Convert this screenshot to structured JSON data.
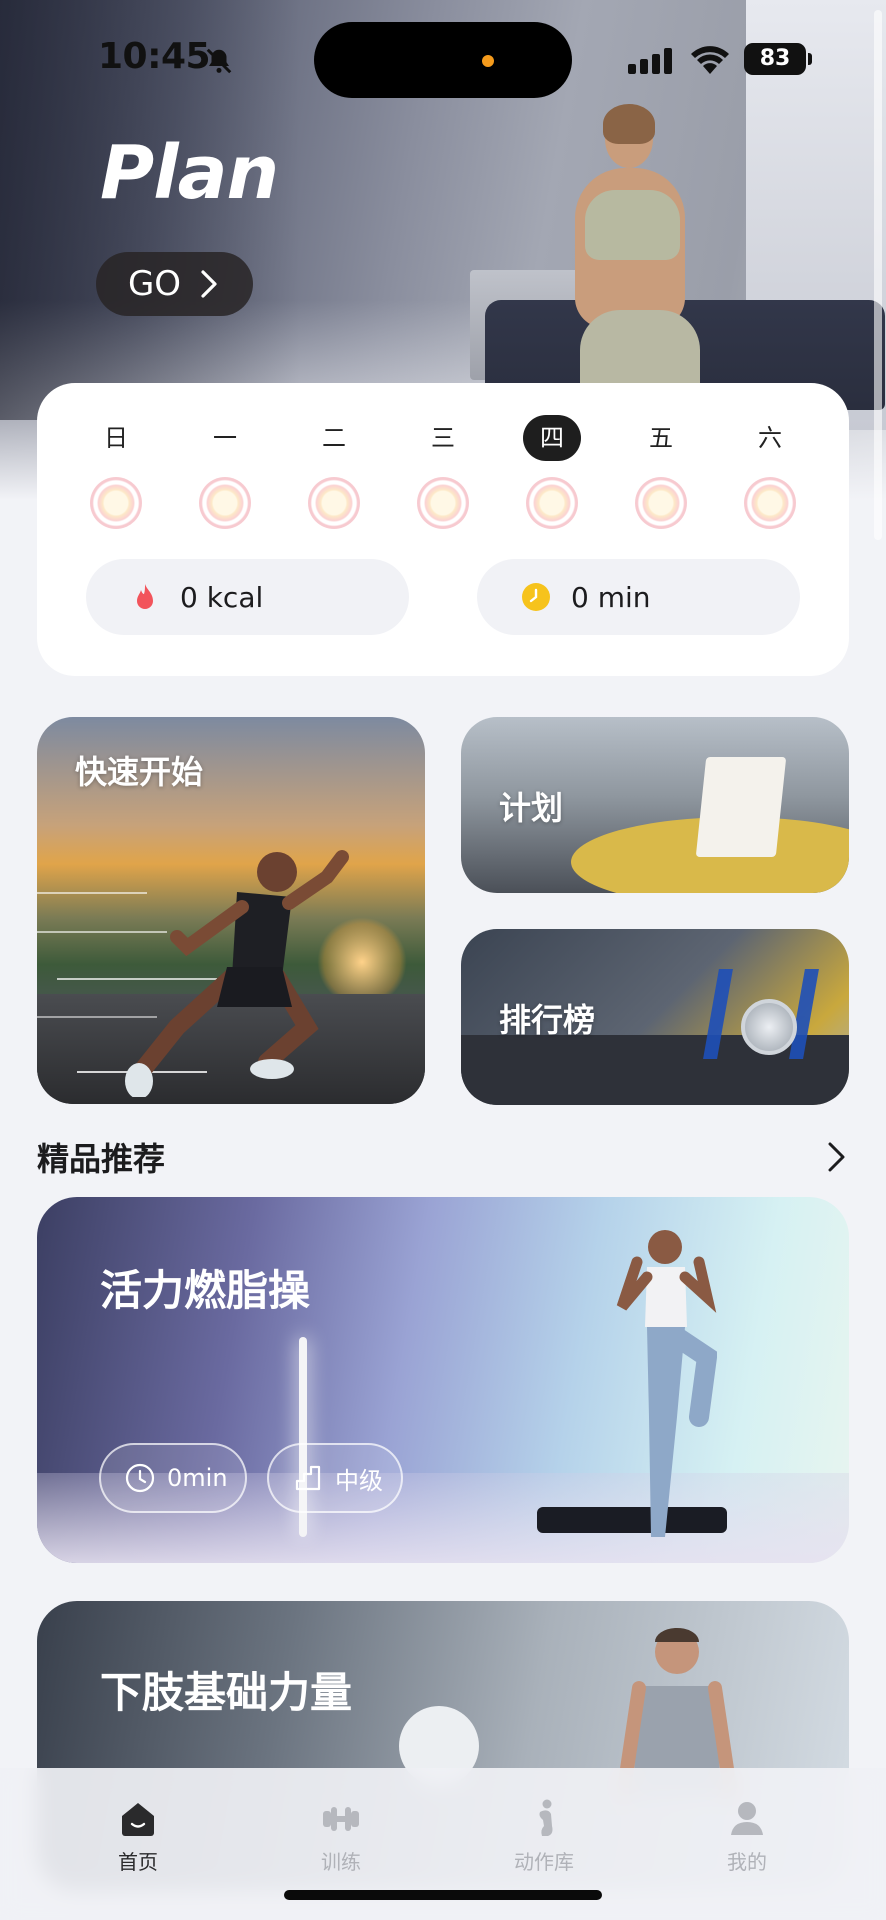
{
  "status": {
    "time": "10:45",
    "battery": "83"
  },
  "hero": {
    "title": "Plan",
    "go_label": "GO"
  },
  "week": {
    "days": [
      "日",
      "一",
      "二",
      "三",
      "四",
      "五",
      "六"
    ],
    "active_day": "四",
    "calories": "0 kcal",
    "duration": "0 min"
  },
  "tiles": {
    "quick_start": "快速开始",
    "plan": "计划",
    "ranking": "排行榜"
  },
  "featured": {
    "title": "精品推荐",
    "items": [
      {
        "title": "活力燃脂操",
        "duration": "0min",
        "level": "中级"
      },
      {
        "title": "下肢基础力量"
      }
    ]
  },
  "tabbar": {
    "items": [
      {
        "label": "首页",
        "icon": "home-icon",
        "active": true
      },
      {
        "label": "训练",
        "icon": "dumbbell-icon",
        "active": false
      },
      {
        "label": "动作库",
        "icon": "stretch-person-icon",
        "active": false
      },
      {
        "label": "我的",
        "icon": "profile-icon",
        "active": false
      }
    ]
  },
  "colors": {
    "accent_dark": "#1e1e1e",
    "flame": "#f2545b",
    "clock_yellow": "#f6c31c",
    "background": "#f2f3f7"
  }
}
